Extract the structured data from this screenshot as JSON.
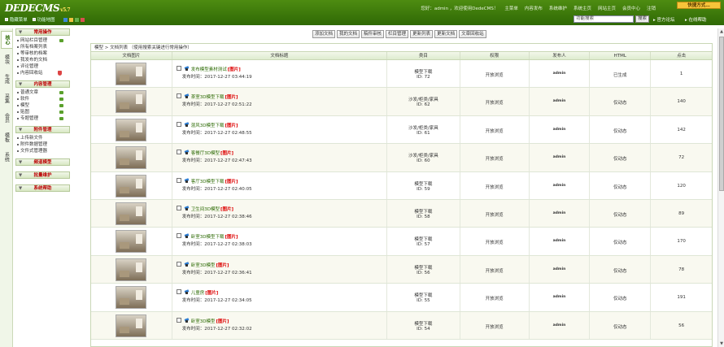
{
  "header": {
    "logo": "DEDECMS",
    "version": "v5.7",
    "hide_menu": "隐藏菜单",
    "site_map": "功能地图",
    "greeting": "您好：admin ，欢迎使用DedeCMS！",
    "nav": [
      "主菜单",
      "内容发布",
      "系统维护",
      "系统主页",
      "网站主页",
      "会员中心",
      "注销"
    ],
    "quick": "快捷方式…",
    "search_value": "功能搜索",
    "search_btn": "搜索",
    "forum": "官方论坛",
    "help": "在线帮助",
    "swatch_colors": [
      "#3c8ad8",
      "#f0c040",
      "#66b04a",
      "#d85050"
    ]
  },
  "left_tabs": [
    "核心",
    "模块",
    "生成",
    "采集",
    "会员",
    "模板",
    "系统"
  ],
  "menu": {
    "groups": [
      {
        "title": "常用操作",
        "items": [
          {
            "label": "网站栏目管理",
            "icon": "plus"
          },
          {
            "label": "所有档案列表"
          },
          {
            "label": "等审核的档案"
          },
          {
            "label": "我发布的文档"
          },
          {
            "label": "评论管理"
          },
          {
            "label": "内容回收站",
            "icon": "shield"
          }
        ]
      },
      {
        "title": "内容管理",
        "items": [
          {
            "label": "普通文章",
            "icon": "plus"
          },
          {
            "label": "软件",
            "icon": "plus"
          },
          {
            "label": "模型",
            "icon": "plus"
          },
          {
            "label": "贴图",
            "icon": "plus"
          },
          {
            "label": "专题管理",
            "icon": "plus"
          }
        ]
      },
      {
        "title": "附件管理",
        "items": [
          {
            "label": "上传新文件"
          },
          {
            "label": "附件数据管理"
          },
          {
            "label": "文件式管理器"
          }
        ]
      },
      {
        "title": "频道模型",
        "items": []
      },
      {
        "title": "批量维护",
        "items": []
      },
      {
        "title": "系统帮助",
        "items": []
      }
    ]
  },
  "toolbar": [
    "添加文档",
    "我的文档",
    "稿件审核",
    "栏目管理",
    "更新列表",
    "更新文档",
    "文章回收站"
  ],
  "breadcrumb": "模型 > 文档列表  （使用搜索关键进行常用操作）",
  "table": {
    "headers": [
      "文档图片",
      "文档标题",
      "类目",
      "权限",
      "发布人",
      "HTML",
      "点击"
    ],
    "rows": [
      {
        "title": "发布模型素材测试",
        "tag": "[图片]",
        "date": "发布时间：2017-12-27 03:44:19",
        "cat": "模型下载",
        "id": "ID: 72",
        "perm": "开放浏览",
        "author": "admin",
        "html": "已生成",
        "clicks": "1"
      },
      {
        "title": "茶室3D模型下载",
        "tag": "[图片]",
        "date": "发布时间：2017-12-27 02:51:22",
        "cat": "沙发/柜类/家具",
        "id": "ID: 62",
        "perm": "开放浏览",
        "author": "admin",
        "html": "仅动态",
        "clicks": "140"
      },
      {
        "title": "混风3D模型下载",
        "tag": "[图片]",
        "date": "发布时间：2017-12-27 02:48:55",
        "cat": "沙发/柜类/家具",
        "id": "ID: 61",
        "perm": "开放浏览",
        "author": "admin",
        "html": "仅动态",
        "clicks": "142"
      },
      {
        "title": "客餐厅3D模型",
        "tag": "[图片]",
        "date": "发布时间：2017-12-27 02:47:43",
        "cat": "沙发/柜类/家具",
        "id": "ID: 60",
        "perm": "开放浏览",
        "author": "admin",
        "html": "仅动态",
        "clicks": "72"
      },
      {
        "title": "客厅3D模型下载",
        "tag": "[图片]",
        "date": "发布时间：2017-12-27 02:40:05",
        "cat": "模型下载",
        "id": "ID: 59",
        "perm": "开放浏览",
        "author": "admin",
        "html": "仅动态",
        "clicks": "120"
      },
      {
        "title": "卫生间3D模型",
        "tag": "[图片]",
        "date": "发布时间：2017-12-27 02:38:46",
        "cat": "模型下载",
        "id": "ID: 58",
        "perm": "开放浏览",
        "author": "admin",
        "html": "仅动态",
        "clicks": "89"
      },
      {
        "title": "卧室3D模型下载",
        "tag": "[图片]",
        "date": "发布时间：2017-12-27 02:38:03",
        "cat": "模型下载",
        "id": "ID: 57",
        "perm": "开放浏览",
        "author": "admin",
        "html": "仅动态",
        "clicks": "170"
      },
      {
        "title": "卧室3D模型",
        "tag": "[图片]",
        "date": "发布时间：2017-12-27 02:36:41",
        "cat": "模型下载",
        "id": "ID: 56",
        "perm": "开放浏览",
        "author": "admin",
        "html": "仅动态",
        "clicks": "78"
      },
      {
        "title": "儿童房",
        "tag": "[图片]",
        "date": "发布时间：2017-12-27 02:34:05",
        "cat": "模型下载",
        "id": "ID: 55",
        "perm": "开放浏览",
        "author": "admin",
        "html": "仅动态",
        "clicks": "191"
      },
      {
        "title": "卧室3D模型",
        "tag": "[图片]",
        "date": "发布时间：2017-12-27 02:32:02",
        "cat": "模型下载",
        "id": "ID: 54",
        "perm": "开放浏览",
        "author": "admin",
        "html": "仅动态",
        "clicks": "56"
      }
    ]
  }
}
